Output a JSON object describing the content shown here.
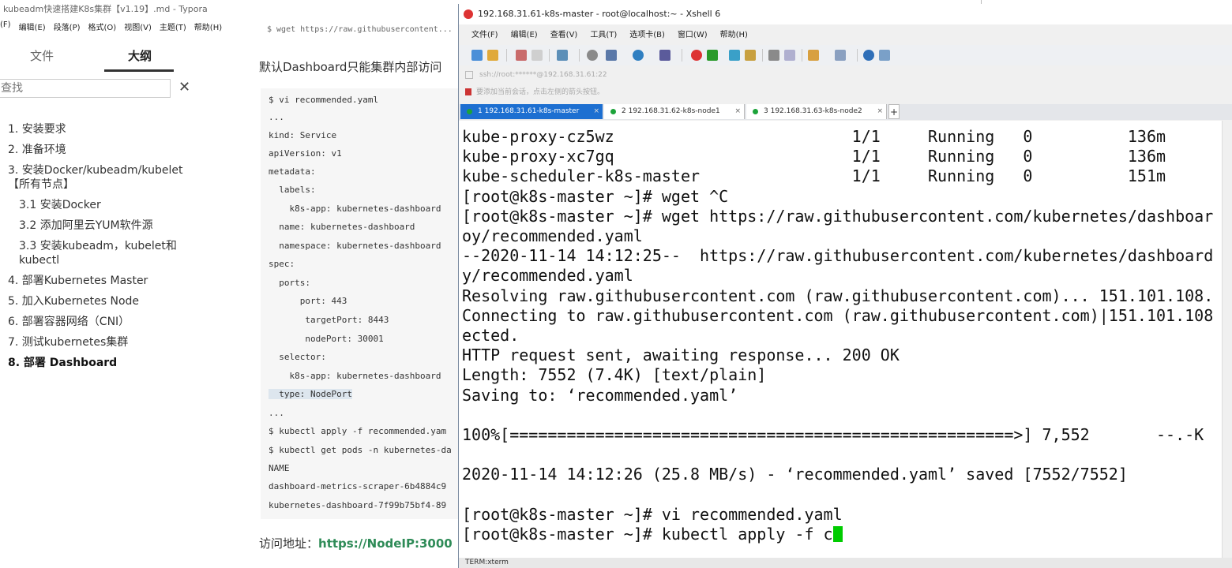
{
  "typora": {
    "title": "kubeadm快速搭建K8s集群【v1.19】.md - Typora",
    "menu": [
      "(F)",
      "编辑(E)",
      "段落(P)",
      "格式(O)",
      "视图(V)",
      "主题(T)",
      "帮助(H)"
    ],
    "sidebar": {
      "tab_files": "文件",
      "tab_outline": "大纲",
      "search_placeholder": "查找",
      "outline": [
        {
          "label": "1. 安装要求",
          "level": 1,
          "active": false
        },
        {
          "label": "2. 准备环境",
          "level": 1,
          "active": false
        },
        {
          "label": "3. 安装Docker/kubeadm/kubelet【所有节点】",
          "level": 1,
          "active": false
        },
        {
          "label": "3.1 安装Docker",
          "level": 2,
          "active": false
        },
        {
          "label": "3.2 添加阿里云YUM软件源",
          "level": 2,
          "active": false
        },
        {
          "label": "3.3 安装kubeadm，kubelet和kubectl",
          "level": 2,
          "active": false
        },
        {
          "label": "4. 部署Kubernetes Master",
          "level": 1,
          "active": false
        },
        {
          "label": "5. 加入Kubernetes Node",
          "level": 1,
          "active": false
        },
        {
          "label": "6. 部署容器网络（CNI）",
          "level": 1,
          "active": false
        },
        {
          "label": "7. 测试kubernetes集群",
          "level": 1,
          "active": false
        },
        {
          "label": "8. 部署 Dashboard",
          "level": 1,
          "active": true
        }
      ]
    },
    "editor": {
      "top_code": "$ wget https://raw.githubusercontent...",
      "paragraph": "默认Dashboard只能集群内部访问",
      "code_lines": [
        "$ vi recommended.yaml",
        "...",
        "kind: Service",
        "apiVersion: v1",
        "metadata:",
        "  labels:",
        "    k8s-app: kubernetes-dashboard",
        "  name: kubernetes-dashboard",
        "  namespace: kubernetes-dashboard",
        "spec:",
        "  ports:",
        "      port: 443",
        "       targetPort: 8443",
        "       nodePort: 30001",
        "  selector:",
        "    k8s-app: kubernetes-dashboard",
        "  type: NodePort",
        "...",
        "$ kubectl apply -f recommended.yam",
        "$ kubectl get pods -n kubernetes-da",
        "NAME",
        "dashboard-metrics-scraper-6b4884c9",
        "kubernetes-dashboard-7f99b75bf4-89"
      ],
      "access_label": "访问地址：",
      "access_link": "https://NodeIP:3000"
    }
  },
  "xshell": {
    "title": "192.168.31.61-k8s-master - root@localhost:~ - Xshell 6",
    "menu": [
      "文件(F)",
      "编辑(E)",
      "查看(V)",
      "工具(T)",
      "选项卡(B)",
      "窗口(W)",
      "帮助(H)"
    ],
    "address": "ssh://root:******@192.168.31.61:22",
    "hint": "要添加当前会话，点击左侧的箭头按钮。",
    "tabs": [
      {
        "label": "1 192.168.31.61-k8s-master",
        "active": true
      },
      {
        "label": "2 192.168.31.62-k8s-node1",
        "active": false
      },
      {
        "label": "3 192.168.31.63-k8s-node2",
        "active": false
      }
    ],
    "add_tab": "+",
    "tab_close": "×",
    "terminal_lines": [
      "kube-proxy-cz5wz                         1/1     Running   0          136m",
      "kube-proxy-xc7gq                         1/1     Running   0          136m",
      "kube-scheduler-k8s-master                1/1     Running   0          151m",
      "[root@k8s-master ~]# wget ^C",
      "[root@k8s-master ~]# wget https://raw.githubusercontent.com/kubernetes/dashboar",
      "oy/recommended.yaml",
      "--2020-11-14 14:12:25--  https://raw.githubusercontent.com/kubernetes/dashboard",
      "y/recommended.yaml",
      "Resolving raw.githubusercontent.com (raw.githubusercontent.com)... 151.101.108.",
      "Connecting to raw.githubusercontent.com (raw.githubusercontent.com)|151.101.108",
      "ected.",
      "HTTP request sent, awaiting response... 200 OK",
      "Length: 7552 (7.4K) [text/plain]",
      "Saving to: ‘recommended.yaml’",
      "",
      "100%[=====================================================>] 7,552       --.-K",
      "",
      "2020-11-14 14:12:26 (25.8 MB/s) - ‘recommended.yaml’ saved [7552/7552]",
      "",
      "[root@k8s-master ~]# vi recommended.yaml",
      "[root@k8s-master ~]# kubectl apply -f c"
    ],
    "status": "TERM:xterm"
  }
}
